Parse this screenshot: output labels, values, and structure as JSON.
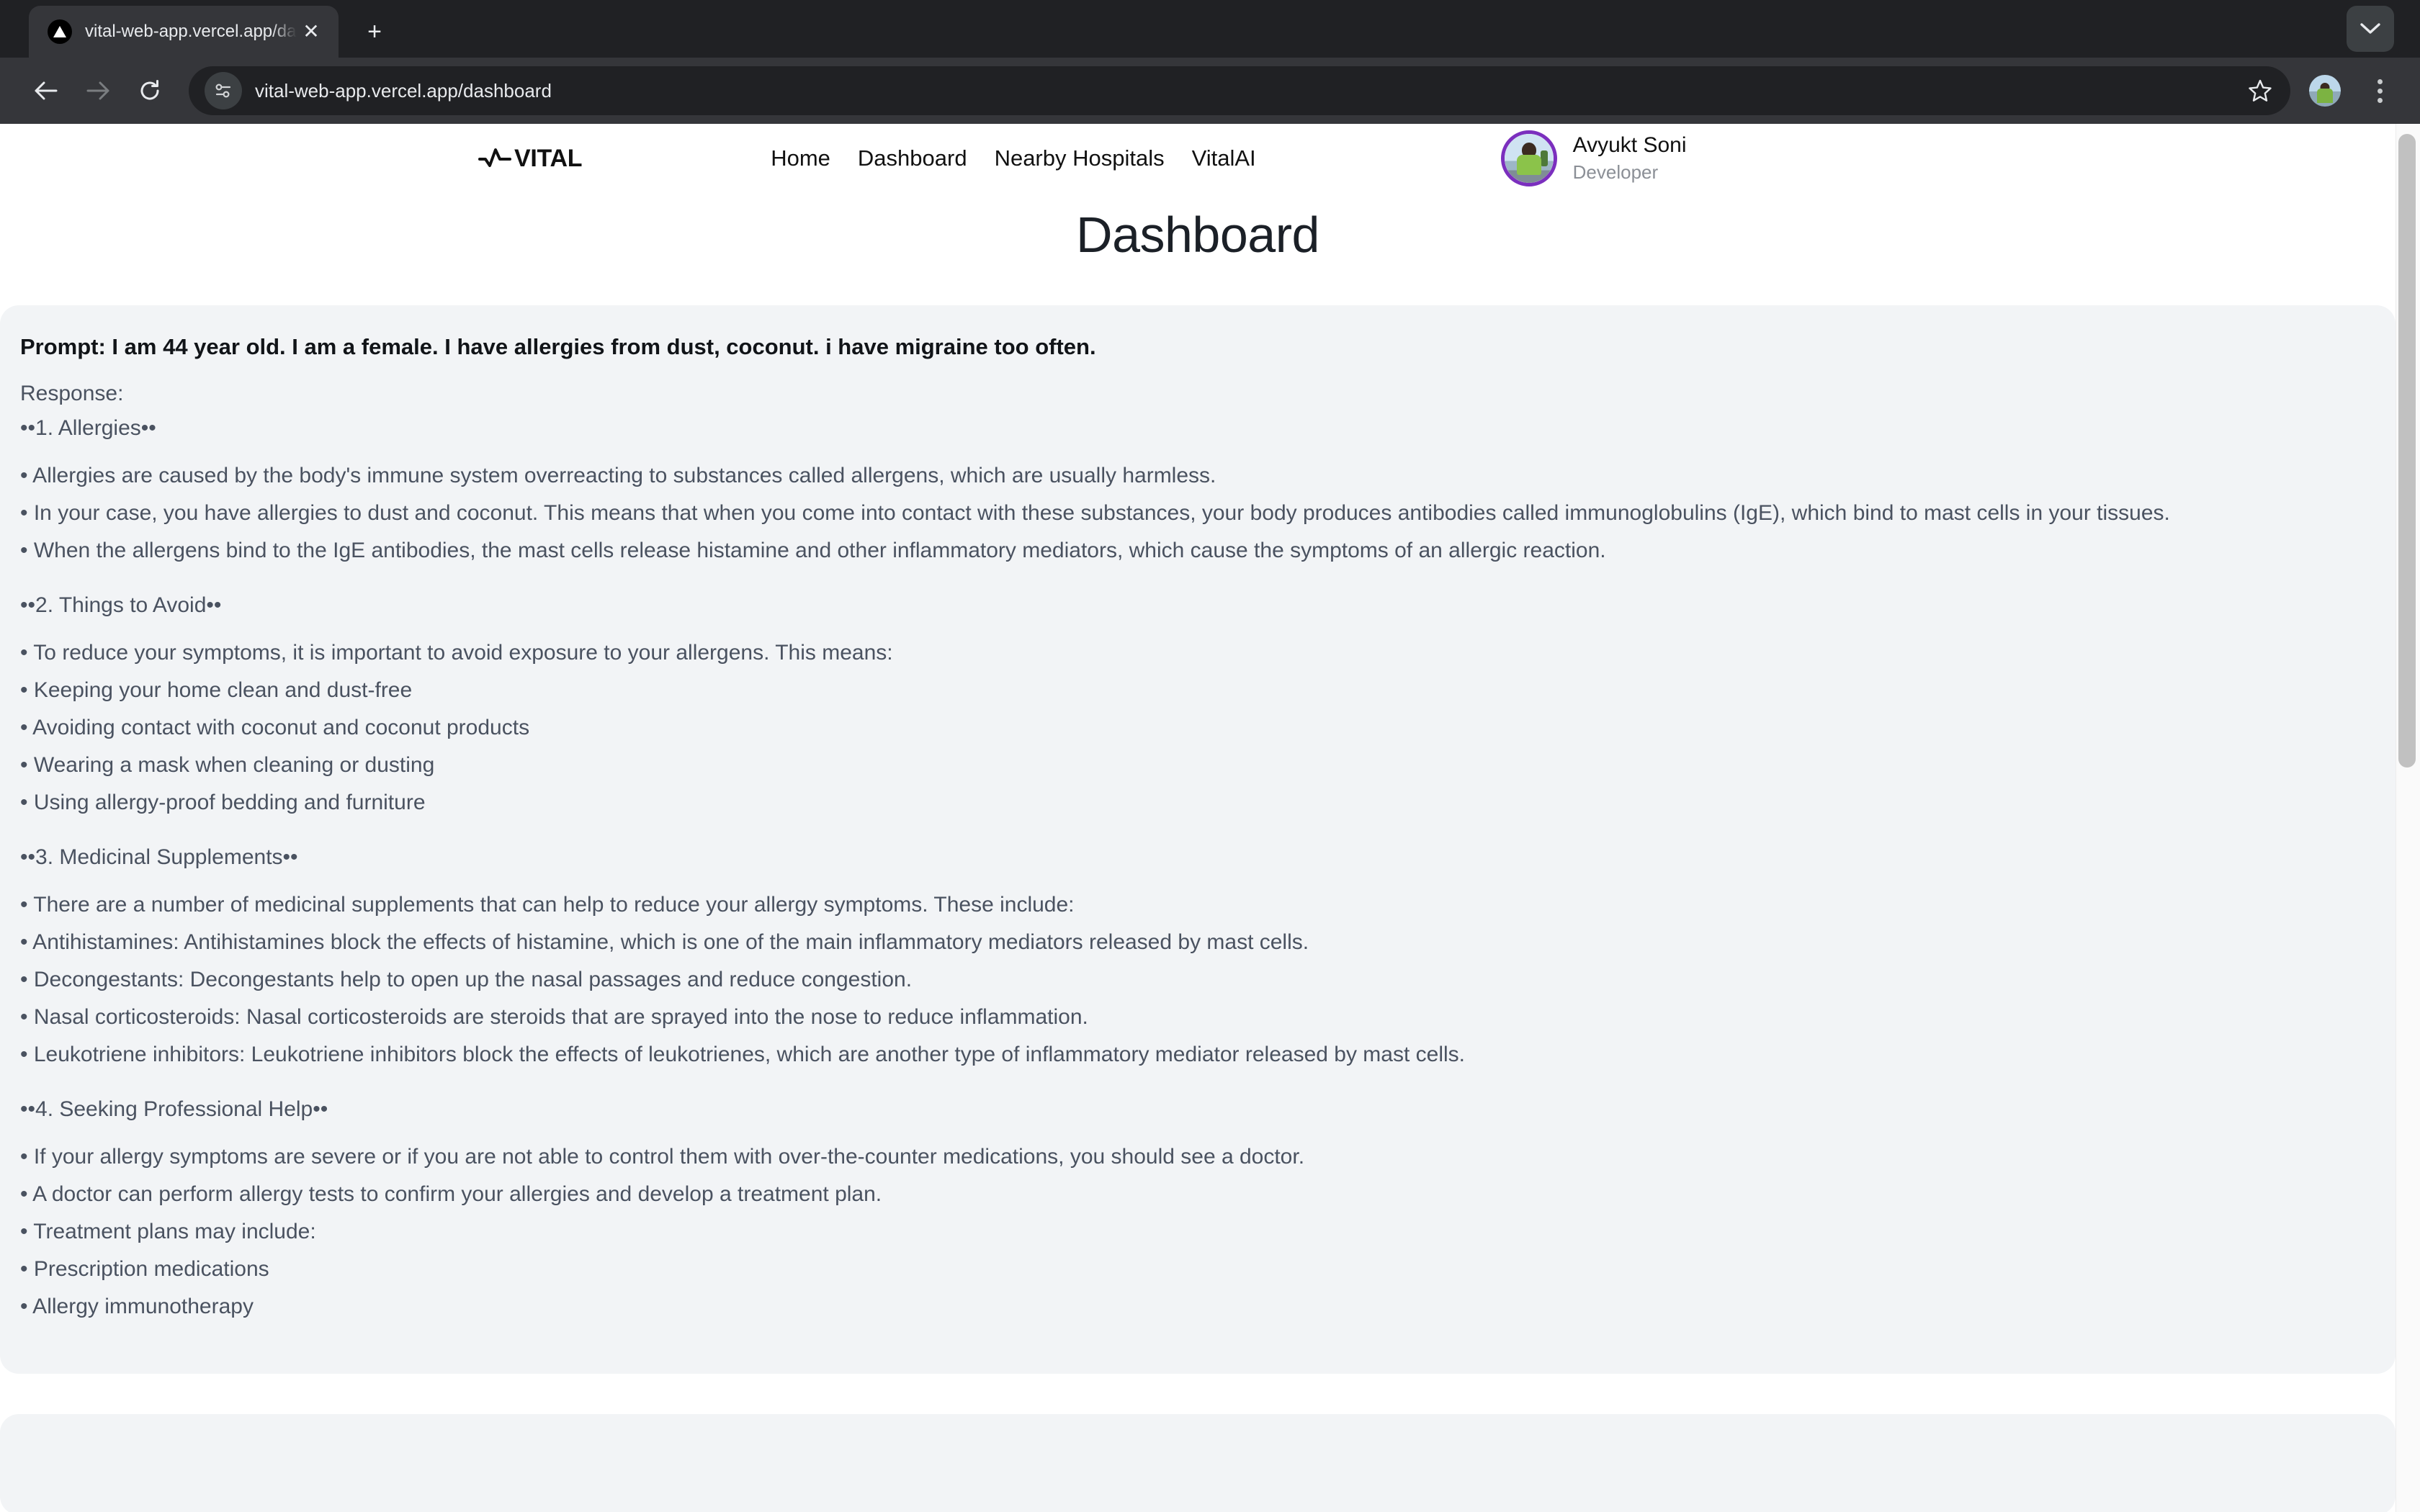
{
  "browser": {
    "tab": {
      "title": "vital-web-app.vercel.app/das",
      "favicon_icon": "vercel-triangle-icon",
      "close_icon": "close-icon"
    },
    "new_tab_label": "+",
    "tab_list_chevron_icon": "chevron-down-icon",
    "toolbar": {
      "back_icon": "back-arrow-icon",
      "forward_icon": "forward-arrow-icon",
      "reload_icon": "reload-icon",
      "site_info_icon": "site-settings-icon",
      "url": "vital-web-app.vercel.app/dashboard",
      "bookmark_icon": "star-icon",
      "profile_icon": "profile-avatar-icon",
      "menu_icon": "three-dot-menu-icon"
    }
  },
  "site": {
    "brand": {
      "logo_icon": "heartbeat-pulse-icon",
      "name": "VITAL"
    },
    "nav": [
      {
        "label": "Home"
      },
      {
        "label": "Dashboard"
      },
      {
        "label": "Nearby Hospitals"
      },
      {
        "label": "VitalAI"
      }
    ],
    "user": {
      "name": "Avyukt Soni",
      "role": "Developer",
      "avatar_icon": "user-avatar-photo",
      "ring_color": "#7b2fbe"
    }
  },
  "main": {
    "page_title": "Dashboard",
    "card": {
      "prompt": "Prompt: I am 44 year old. I am a female. I have allergies from dust, coconut. i have migraine too often.",
      "response_label": "Response:",
      "sections": [
        {
          "heading": "••1. Allergies••",
          "lines": [
            "• Allergies are caused by the body's immune system overreacting to substances called allergens, which are usually harmless.",
            "• In your case, you have allergies to dust and coconut. This means that when you come into contact with these substances, your body produces antibodies called immunoglobulins (IgE), which bind to mast cells in your tissues.",
            "• When the allergens bind to the IgE antibodies, the mast cells release histamine and other inflammatory mediators, which cause the symptoms of an allergic reaction."
          ]
        },
        {
          "heading": "••2. Things to Avoid••",
          "lines": [
            "• To reduce your symptoms, it is important to avoid exposure to your allergens. This means:",
            "• Keeping your home clean and dust-free",
            "• Avoiding contact with coconut and coconut products",
            "• Wearing a mask when cleaning or dusting",
            "• Using allergy-proof bedding and furniture"
          ]
        },
        {
          "heading": "••3. Medicinal Supplements••",
          "lines": [
            "• There are a number of medicinal supplements that can help to reduce your allergy symptoms. These include:",
            "• Antihistamines: Antihistamines block the effects of histamine, which is one of the main inflammatory mediators released by mast cells.",
            "• Decongestants: Decongestants help to open up the nasal passages and reduce congestion.",
            "• Nasal corticosteroids: Nasal corticosteroids are steroids that are sprayed into the nose to reduce inflammation.",
            "• Leukotriene inhibitors: Leukotriene inhibitors block the effects of leukotrienes, which are another type of inflammatory mediator released by mast cells."
          ]
        },
        {
          "heading": "••4. Seeking Professional Help••",
          "lines": [
            "• If your allergy symptoms are severe or if you are not able to control them with over-the-counter medications, you should see a doctor.",
            "• A doctor can perform allergy tests to confirm your allergies and develop a treatment plan.",
            "• Treatment plans may include:",
            "• Prescription medications",
            "• Allergy immunotherapy"
          ]
        }
      ]
    }
  },
  "colors": {
    "card_bg": "#f2f4f6",
    "body_text": "#4a5260",
    "heading_text": "#111418",
    "accent_purple": "#7b2fbe"
  }
}
